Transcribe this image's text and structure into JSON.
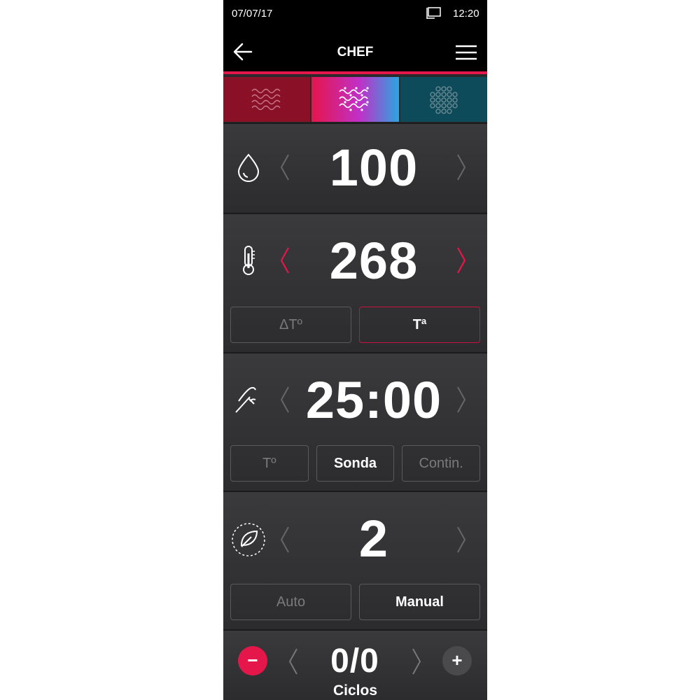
{
  "status": {
    "date": "07/07/17",
    "time": "12:20",
    "screen_icon": "display-icon"
  },
  "appbar": {
    "title": "CHEF",
    "back_icon": "back-arrow-icon",
    "menu_icon": "hamburger-menu-icon"
  },
  "modes": [
    {
      "icon": "steam-waves-icon",
      "selected": false
    },
    {
      "icon": "combi-waves-icon",
      "selected": true
    },
    {
      "icon": "dots-grid-icon",
      "selected": false
    }
  ],
  "humidity": {
    "icon": "water-drop-icon",
    "value": "100"
  },
  "temperature": {
    "icon": "thermometer-icon",
    "value": "268",
    "options": [
      "ΔTº",
      "Tª"
    ],
    "selected": "Tª"
  },
  "time": {
    "icon": "probe-icon",
    "value": "25:00",
    "options": [
      "Tº",
      "Sonda",
      "Contin."
    ],
    "selected": "Sonda"
  },
  "cycles_mode": {
    "icon": "leaf-cycle-icon",
    "value": "2",
    "options": [
      "Auto",
      "Manual"
    ],
    "selected": "Manual"
  },
  "cycles": {
    "value": "0/0",
    "label": "Ciclos",
    "minus": "−",
    "plus": "+"
  },
  "colors": {
    "accent": "#e5174a",
    "background": "#2a2a2c",
    "topbar": "#000000"
  }
}
